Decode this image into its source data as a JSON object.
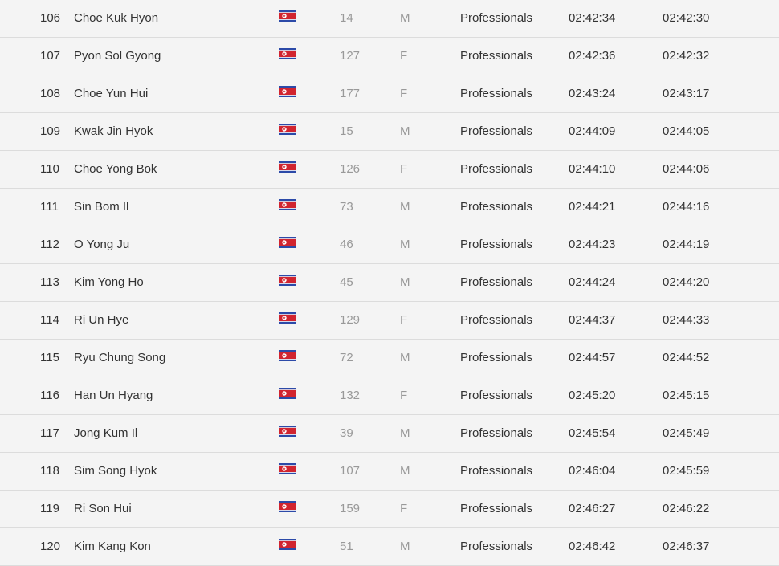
{
  "results": {
    "rows": [
      {
        "place": "106",
        "name": "Choe Kuk Hyon",
        "flag": "north-korea-flag-icon",
        "bib": "14",
        "sex": "M",
        "category": "Professionals",
        "gun_time": "02:42:34",
        "chip_time": "02:42:30"
      },
      {
        "place": "107",
        "name": "Pyon Sol Gyong",
        "flag": "north-korea-flag-icon",
        "bib": "127",
        "sex": "F",
        "category": "Professionals",
        "gun_time": "02:42:36",
        "chip_time": "02:42:32"
      },
      {
        "place": "108",
        "name": "Choe Yun Hui",
        "flag": "north-korea-flag-icon",
        "bib": "177",
        "sex": "F",
        "category": "Professionals",
        "gun_time": "02:43:24",
        "chip_time": "02:43:17"
      },
      {
        "place": "109",
        "name": "Kwak Jin Hyok",
        "flag": "north-korea-flag-icon",
        "bib": "15",
        "sex": "M",
        "category": "Professionals",
        "gun_time": "02:44:09",
        "chip_time": "02:44:05"
      },
      {
        "place": "110",
        "name": "Choe Yong Bok",
        "flag": "north-korea-flag-icon",
        "bib": "126",
        "sex": "F",
        "category": "Professionals",
        "gun_time": "02:44:10",
        "chip_time": "02:44:06"
      },
      {
        "place": "111",
        "name": "Sin Bom Il",
        "flag": "north-korea-flag-icon",
        "bib": "73",
        "sex": "M",
        "category": "Professionals",
        "gun_time": "02:44:21",
        "chip_time": "02:44:16"
      },
      {
        "place": "112",
        "name": "O Yong Ju",
        "flag": "north-korea-flag-icon",
        "bib": "46",
        "sex": "M",
        "category": "Professionals",
        "gun_time": "02:44:23",
        "chip_time": "02:44:19"
      },
      {
        "place": "113",
        "name": "Kim Yong Ho",
        "flag": "north-korea-flag-icon",
        "bib": "45",
        "sex": "M",
        "category": "Professionals",
        "gun_time": "02:44:24",
        "chip_time": "02:44:20"
      },
      {
        "place": "114",
        "name": "Ri Un Hye",
        "flag": "north-korea-flag-icon",
        "bib": "129",
        "sex": "F",
        "category": "Professionals",
        "gun_time": "02:44:37",
        "chip_time": "02:44:33"
      },
      {
        "place": "115",
        "name": "Ryu Chung Song",
        "flag": "north-korea-flag-icon",
        "bib": "72",
        "sex": "M",
        "category": "Professionals",
        "gun_time": "02:44:57",
        "chip_time": "02:44:52"
      },
      {
        "place": "116",
        "name": "Han Un Hyang",
        "flag": "north-korea-flag-icon",
        "bib": "132",
        "sex": "F",
        "category": "Professionals",
        "gun_time": "02:45:20",
        "chip_time": "02:45:15"
      },
      {
        "place": "117",
        "name": "Jong Kum Il",
        "flag": "north-korea-flag-icon",
        "bib": "39",
        "sex": "M",
        "category": "Professionals",
        "gun_time": "02:45:54",
        "chip_time": "02:45:49"
      },
      {
        "place": "118",
        "name": "Sim Song Hyok",
        "flag": "north-korea-flag-icon",
        "bib": "107",
        "sex": "M",
        "category": "Professionals",
        "gun_time": "02:46:04",
        "chip_time": "02:45:59"
      },
      {
        "place": "119",
        "name": "Ri Son Hui",
        "flag": "north-korea-flag-icon",
        "bib": "159",
        "sex": "F",
        "category": "Professionals",
        "gun_time": "02:46:27",
        "chip_time": "02:46:22"
      },
      {
        "place": "120",
        "name": "Kim Kang Kon",
        "flag": "north-korea-flag-icon",
        "bib": "51",
        "sex": "M",
        "category": "Professionals",
        "gun_time": "02:46:42",
        "chip_time": "02:46:37"
      }
    ]
  },
  "colors": {
    "background": "#f4f4f4",
    "row_divider": "#dcdcdc",
    "primary_text": "#333333",
    "muted_text": "#999999",
    "flag_blue": "#2c4aa8",
    "flag_red": "#d1242f",
    "flag_white": "#ffffff"
  }
}
